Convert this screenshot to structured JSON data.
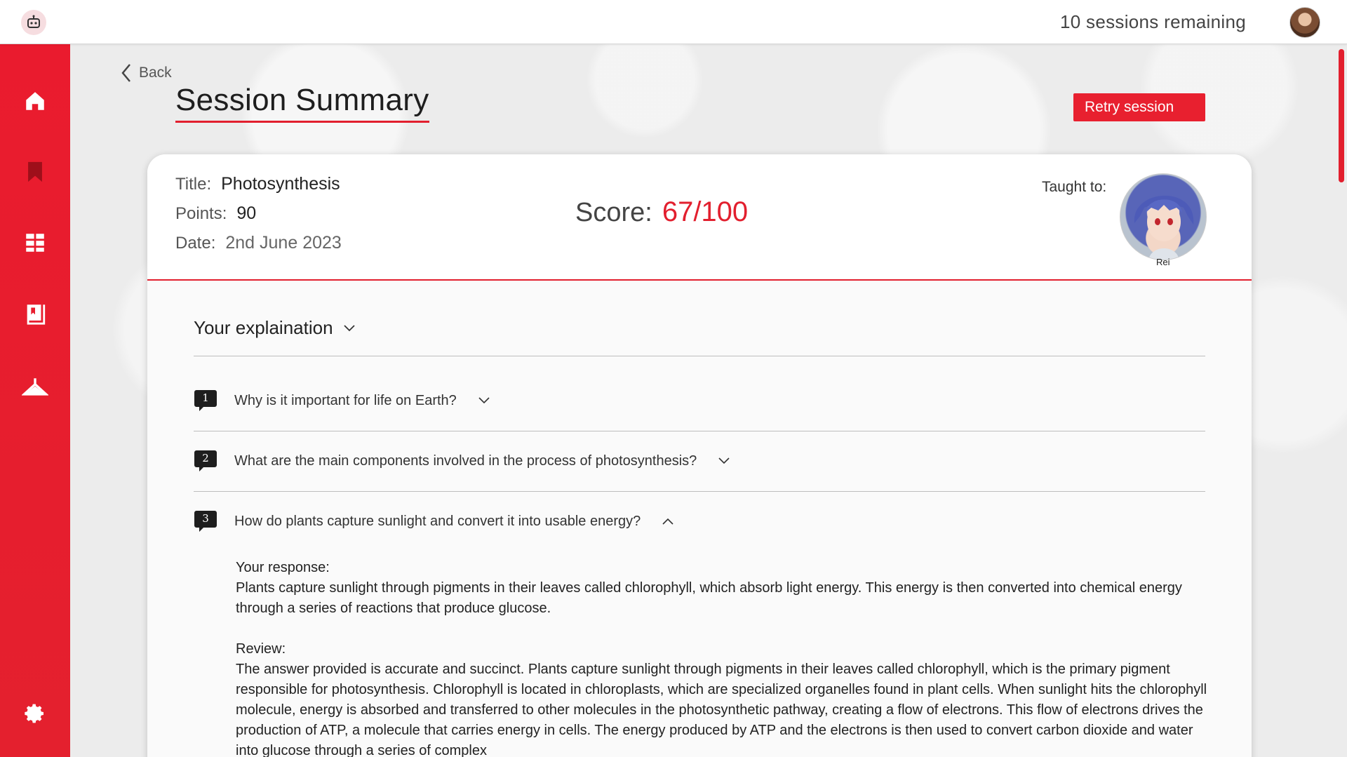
{
  "topbar": {
    "sessions_remaining": "10 sessions remaining"
  },
  "sidebar": {
    "items": [
      {
        "icon": "home-icon"
      },
      {
        "icon": "bookmark-icon"
      },
      {
        "icon": "dashboard-icon"
      },
      {
        "icon": "book-icon"
      },
      {
        "icon": "hanger-icon"
      },
      {
        "icon": "gear-icon"
      }
    ]
  },
  "page": {
    "back_label": "Back",
    "title": "Session Summary",
    "retry_label": "Retry session"
  },
  "summary": {
    "title_label": "Title:",
    "title_value": "Photosynthesis",
    "points_label": "Points:",
    "points_value": "90",
    "date_label": "Date:",
    "date_value": "2nd June 2023",
    "score_label": "Score:",
    "score_value": "67/100",
    "taught_label": "Taught to:",
    "taught_name": "Rei"
  },
  "explanation": {
    "heading": "Your explaination",
    "questions": [
      {
        "num": "1",
        "text": "Why is it important for life on Earth?"
      },
      {
        "num": "2",
        "text": "What are the main components involved in the process of photosynthesis?"
      },
      {
        "num": "3",
        "text": "How do plants capture sunlight and convert it into usable energy?"
      }
    ],
    "response_label": "Your response:",
    "response_text": "Plants capture sunlight through pigments in their leaves called chlorophyll, which absorb light energy. This energy is then converted into chemical energy through a series of reactions that produce glucose.",
    "review_label": "Review:",
    "review_text": "The answer provided is accurate and succinct. Plants capture sunlight through pigments in their leaves called chlorophyll, which is the primary pigment responsible for photosynthesis. Chlorophyll is located in chloroplasts, which are specialized organelles found in plant cells. When sunlight hits the chlorophyll molecule, energy is absorbed and transferred to other molecules in the photosynthetic pathway, creating a flow of electrons. This flow of electrons drives the production of ATP, a molecule that carries energy in cells. The energy produced by ATP and the electrons is then used to convert carbon dioxide and water into glucose through a series of complex"
  },
  "colors": {
    "accent": "#e21f2e",
    "sidebar": "#ea1b2e"
  }
}
